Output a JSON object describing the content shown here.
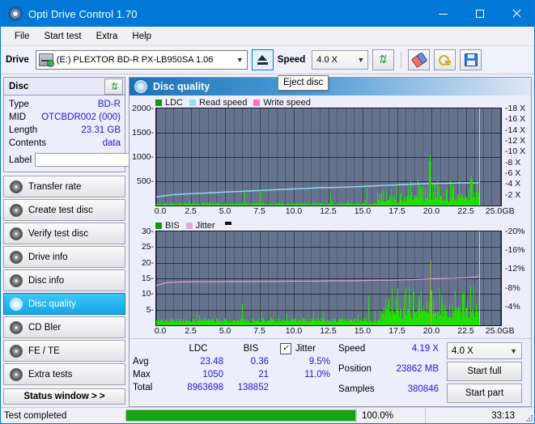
{
  "window": {
    "title": "Opti Drive Control 1.70",
    "icon": "disc-icon",
    "minimize": "–",
    "maximize": "□",
    "close": "×"
  },
  "menu": [
    {
      "label": "File"
    },
    {
      "label": "Start test"
    },
    {
      "label": "Extra"
    },
    {
      "label": "Help"
    }
  ],
  "toolbar": {
    "drive_label": "Drive",
    "drive_value": "(E:)  PLEXTOR BD-R  PX-LB950SA 1.06",
    "eject_button": "eject-icon",
    "speed_label": "Speed",
    "speed_value": "4.0 X",
    "refresh_button": "refresh-icon",
    "erase_button": "erase-icon",
    "key_button": "key-icon",
    "save_button": "save-icon"
  },
  "sidebar": {
    "disc_panel": {
      "title": "Disc",
      "refresh_icon": "refresh-icon",
      "rows": [
        {
          "key": "Type",
          "value": "BD-R"
        },
        {
          "key": "MID",
          "value": "OTCBDR002 (000)"
        },
        {
          "key": "Length",
          "value": "23.31 GB"
        },
        {
          "key": "Contents",
          "value": "data"
        }
      ],
      "label_key": "Label",
      "label_value": "",
      "label_placeholder": "",
      "label_button_icon": "disc-label-icon"
    },
    "items": [
      {
        "label": "Transfer rate",
        "active": false
      },
      {
        "label": "Create test disc",
        "active": false
      },
      {
        "label": "Verify test disc",
        "active": false
      },
      {
        "label": "Drive info",
        "active": false
      },
      {
        "label": "Disc info",
        "active": false
      },
      {
        "label": "Disc quality",
        "active": true
      },
      {
        "label": "CD Bler",
        "active": false
      },
      {
        "label": "FE / TE",
        "active": false
      },
      {
        "label": "Extra tests",
        "active": false
      }
    ],
    "status_window_button": "Status window > >"
  },
  "main": {
    "panel_title": "Disc quality",
    "panel_icon": "disc-quality-icon",
    "tooltip": "Eject disc"
  },
  "chart_data": [
    {
      "type": "bar",
      "title": "Disc quality - LDC",
      "xlabel": "GB",
      "ylabel": "",
      "xlim": [
        0,
        25
      ],
      "ylim": [
        0,
        2000
      ],
      "y2lim": [
        0,
        18
      ],
      "grid": true,
      "legend_position": "top-left",
      "legend": [
        {
          "name": "LDC",
          "color": "#21e000"
        },
        {
          "name": "Read speed",
          "color": "#8fddf5"
        },
        {
          "name": "Write speed",
          "color": "#ff6fd0"
        }
      ],
      "xticks": [
        "0.0",
        "2.5",
        "5.0",
        "7.5",
        "10.0",
        "12.5",
        "15.0",
        "17.5",
        "20.0",
        "22.5",
        "25.0"
      ],
      "yticks_left": [
        "500",
        "1000",
        "1500",
        "2000"
      ],
      "yticks_right": [
        "2 X",
        "4 X",
        "6 X",
        "8 X",
        "10 X",
        "12 X",
        "14 X",
        "16 X",
        "18 X"
      ],
      "xunit": "GB",
      "cursor_x": 23.43,
      "series": [
        {
          "name": "Read speed",
          "color": "#8fddf5",
          "axis": "right",
          "x": [
            0.0,
            0.6,
            1.2,
            1.9,
            2.6,
            3.4,
            4.2,
            5.0,
            5.9,
            6.8,
            7.6,
            8.4,
            9.3,
            10.2,
            11.0,
            11.9,
            12.8,
            13.7,
            14.6,
            15.5,
            16.3,
            17.2,
            18.0,
            18.9,
            19.8,
            20.7,
            21.6,
            22.4,
            23.2,
            23.4
          ],
          "values": [
            1.6,
            1.8,
            2.0,
            2.1,
            2.2,
            2.3,
            2.4,
            2.5,
            2.6,
            2.7,
            2.8,
            2.9,
            3.0,
            3.1,
            3.2,
            3.3,
            3.35,
            3.4,
            3.5,
            3.6,
            3.7,
            3.8,
            3.9,
            4.0,
            4.05,
            4.1,
            4.15,
            4.2,
            4.2,
            4.2
          ]
        }
      ]
    },
    {
      "type": "bar",
      "title": "Disc quality - BIS / Jitter",
      "xlabel": "GB",
      "xlim": [
        0,
        25
      ],
      "ylim": [
        0,
        30
      ],
      "y2lim": [
        0,
        20
      ],
      "grid": true,
      "legend_position": "top-left",
      "legend": [
        {
          "name": "BIS",
          "color": "#21e000"
        },
        {
          "name": "Jitter",
          "color": "#e6a8dc"
        }
      ],
      "xticks": [
        "0.0",
        "2.5",
        "5.0",
        "7.5",
        "10.0",
        "12.5",
        "15.0",
        "17.5",
        "20.0",
        "22.5",
        "25.0"
      ],
      "yticks_left": [
        "5",
        "10",
        "15",
        "20",
        "25",
        "30"
      ],
      "yticks_right": [
        "4%",
        "8%",
        "12%",
        "16%",
        "20%"
      ],
      "xunit": "GB",
      "cursor_x": 23.43,
      "series": [
        {
          "name": "Jitter",
          "color": "#e6a8dc",
          "axis": "right",
          "x": [
            0.0,
            0.8,
            1.6,
            2.4,
            3.2,
            4.0,
            4.8,
            5.6,
            6.4,
            7.2,
            8.0,
            8.8,
            9.6,
            10.4,
            11.2,
            12.0,
            12.8,
            13.6,
            14.4,
            15.2,
            16.0,
            16.8,
            17.6,
            18.4,
            19.2,
            20.0,
            20.8,
            21.6,
            22.4,
            23.2,
            23.4
          ],
          "values": [
            8.5,
            9.1,
            9.2,
            9.25,
            9.3,
            9.3,
            9.3,
            9.35,
            9.3,
            9.35,
            9.35,
            9.35,
            9.4,
            9.4,
            9.4,
            9.45,
            9.5,
            9.5,
            9.5,
            9.55,
            9.6,
            9.6,
            9.65,
            9.7,
            9.8,
            9.9,
            9.95,
            10.0,
            10.1,
            10.3,
            10.4
          ]
        }
      ]
    }
  ],
  "stats": {
    "headers": [
      "",
      "LDC",
      "BIS"
    ],
    "rows": [
      {
        "label": "Avg",
        "ldc": "23.48",
        "bis": "0.36"
      },
      {
        "label": "Max",
        "ldc": "1050",
        "bis": "21"
      },
      {
        "label": "Total",
        "ldc": "8963698",
        "bis": "138852"
      }
    ],
    "jitter": {
      "checked": true,
      "check_glyph": "✓",
      "label": "Jitter",
      "avg": "9.5%",
      "max": "11.0%"
    },
    "right": [
      {
        "key": "Speed",
        "value": "4.19 X"
      },
      {
        "key": "Position",
        "value": "23862 MB"
      },
      {
        "key": "Samples",
        "value": "380846"
      }
    ],
    "speed_select": "4.0 X",
    "start_full": "Start full",
    "start_part": "Start part"
  },
  "statusbar": {
    "message": "Test completed",
    "progress_percent": 100.0,
    "progress_text": "100.0%",
    "elapsed": "33:13"
  },
  "colors": {
    "accent": "#0078d7",
    "plot_bg": "#66738f",
    "bar_green": "#21e000",
    "bar_amber": "#c9b400",
    "read_speed": "#8fddf5",
    "write_speed": "#ff6fd0",
    "jitter": "#e6a8dc",
    "cursor": "#7fe4ff",
    "value_blue": "#1a1ae0",
    "progress_green": "#16a416"
  }
}
